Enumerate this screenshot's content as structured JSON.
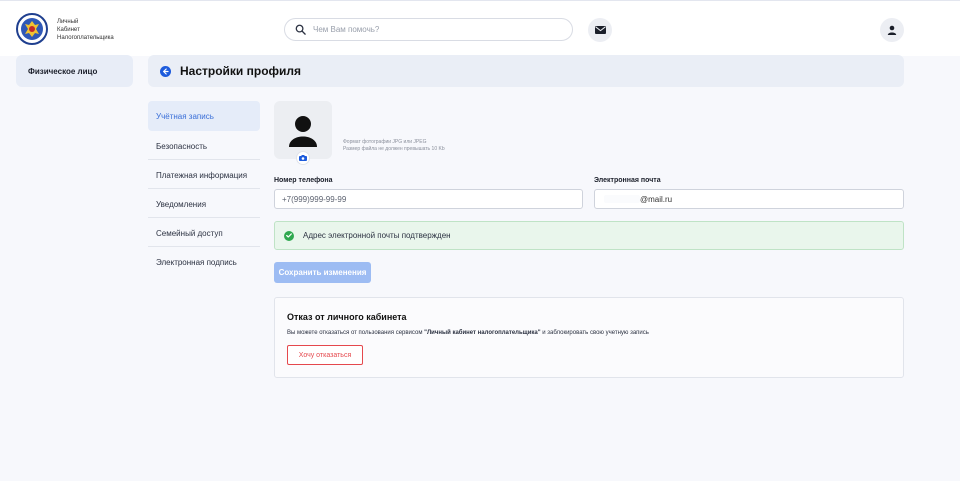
{
  "brand": {
    "line1": "Личный",
    "line2": "Кабинет",
    "line3": "Налогоплательщика",
    "logo_icon": "fns-emblem-icon"
  },
  "search": {
    "placeholder": "Чем Вам помочь?",
    "value": ""
  },
  "topbar": {
    "mail_icon": "mail-icon",
    "user_icon": "user-icon"
  },
  "sidebar": {
    "profile_type": "Физическое лицо"
  },
  "page": {
    "title": "Настройки профиля",
    "back_icon": "arrow-left-icon"
  },
  "menu": {
    "items": [
      {
        "label": "Учётная запись",
        "active": true
      },
      {
        "label": "Безопасность"
      },
      {
        "label": "Платежная информация"
      },
      {
        "label": "Уведомления"
      },
      {
        "label": "Семейный доступ"
      },
      {
        "label": "Электронная подпись"
      }
    ]
  },
  "photo": {
    "hint_line1": "Формат фотографии JPG или JPEG",
    "hint_line2": "Размер файла не должен превышать 10 Kb",
    "camera_icon": "camera-icon"
  },
  "form": {
    "phone_label": "Номер телефона",
    "phone_placeholder": "+7(999)999-99-99",
    "email_label": "Электронная почта",
    "email_value": "@mail.ru"
  },
  "notice": {
    "text": "Адрес электронной почты подтвержден",
    "icon": "check-circle-icon"
  },
  "actions": {
    "save_label": "Сохранить изменения"
  },
  "refuse": {
    "title": "Отказ от личного кабинета",
    "text_before": "Вы можете отказаться от пользования сервисом ",
    "service_name": "\"Личный кабинет налогоплательщика\"",
    "text_after": " и заблокировать свою учетную запись",
    "button_label": "Хочу отказаться"
  },
  "colors": {
    "accent": "#1d5bdc",
    "save_disabled": "#9dbcf3",
    "danger": "#e5484d",
    "success_bg": "#e9f6ec",
    "success_icon": "#2fa84f"
  }
}
